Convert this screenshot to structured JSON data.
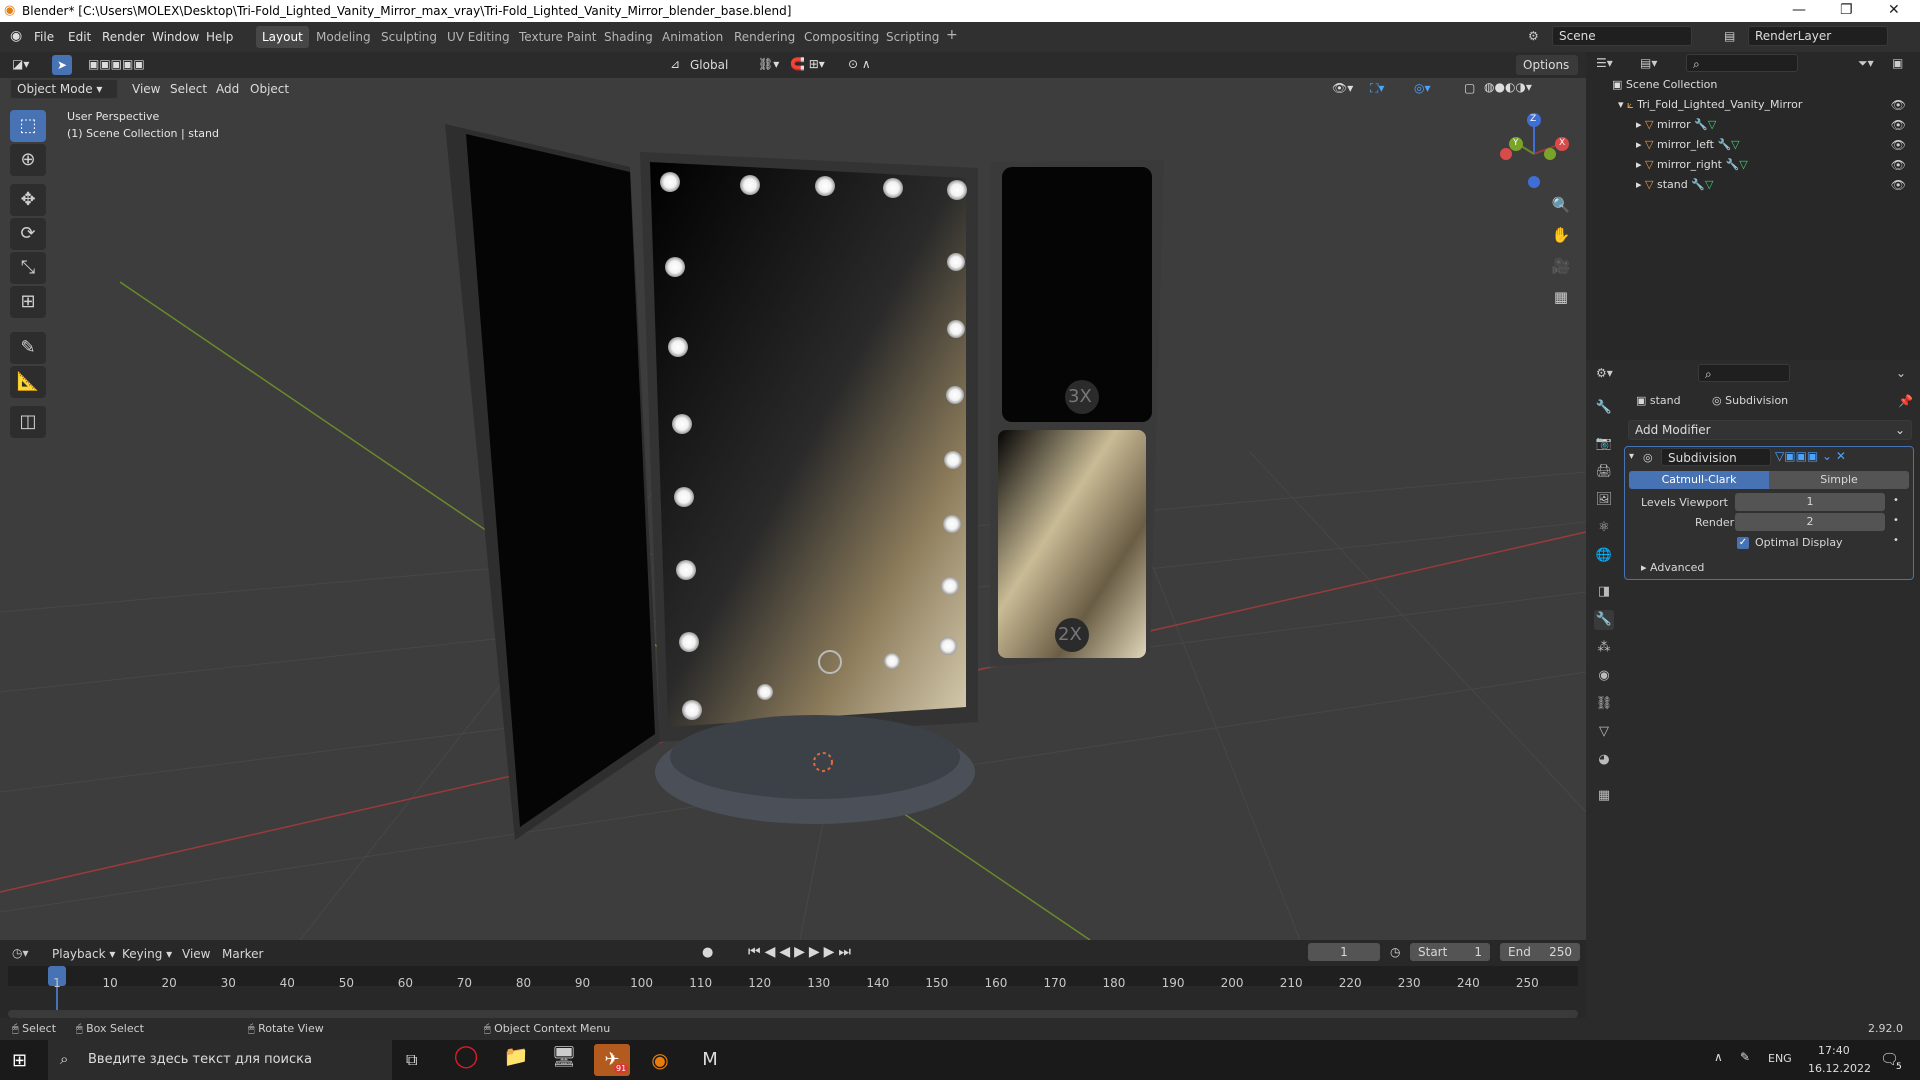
{
  "window": {
    "title": "Blender* [C:\\Users\\MOLEX\\Desktop\\Tri-Fold_Lighted_Vanity_Mirror_max_vray\\Tri-Fold_Lighted_Vanity_Mirror_blender_base.blend]"
  },
  "menu": [
    "File",
    "Edit",
    "Render",
    "Window",
    "Help"
  ],
  "workspaces": [
    "Layout",
    "Modeling",
    "Sculpting",
    "UV Editing",
    "Texture Paint",
    "Shading",
    "Animation",
    "Rendering",
    "Compositing",
    "Scripting"
  ],
  "scene": {
    "label": "Scene",
    "render_layer": "RenderLayer"
  },
  "viewport": {
    "transform": "Global",
    "options": "Options",
    "mode": "Object Mode",
    "menus": [
      "View",
      "Select",
      "Add",
      "Object"
    ],
    "overlay_title": "User Perspective",
    "overlay_sub": "(1) Scene Collection | stand",
    "mirror_labels": {
      "top": "3X",
      "bottom": "2X"
    },
    "gizmo": {
      "x": "X",
      "y": "Y",
      "z": "Z"
    }
  },
  "outliner": {
    "root": "Scene Collection",
    "collection": "Tri_Fold_Lighted_Vanity_Mirror",
    "objects": [
      "mirror",
      "mirror_left",
      "mirror_right",
      "stand"
    ]
  },
  "properties": {
    "object": "stand",
    "modifier_label": "Subdivision",
    "add_modifier": "Add Modifier",
    "modifier_name": "Subdivision",
    "tabs": [
      "Catmull-Clark",
      "Simple"
    ],
    "levels_viewport_label": "Levels Viewport",
    "levels_viewport": "1",
    "render_label": "Render",
    "render": "2",
    "optimal_display": "Optimal Display",
    "optimal_checked": true,
    "advanced": "Advanced"
  },
  "timeline": {
    "menus": [
      "Playback",
      "Keying",
      "View",
      "Marker"
    ],
    "current_frame": "1",
    "start_label": "Start",
    "start": "1",
    "end_label": "End",
    "end": "250",
    "ticks": [
      "1",
      "10",
      "20",
      "30",
      "40",
      "50",
      "60",
      "70",
      "80",
      "90",
      "100",
      "110",
      "120",
      "130",
      "140",
      "150",
      "160",
      "170",
      "180",
      "190",
      "200",
      "210",
      "220",
      "230",
      "240",
      "250"
    ]
  },
  "statusbar": {
    "select": "Select",
    "box_select": "Box Select",
    "rotate": "Rotate View",
    "context": "Object Context Menu",
    "version": "2.92.0"
  },
  "taskbar": {
    "search_placeholder": "Введите здесь текст для поиска",
    "lang": "ENG",
    "time": "17:40",
    "date": "16.12.2022",
    "notif_count": "5",
    "telegram_badge": "91"
  },
  "colors": {
    "accent": "#4772b3",
    "active_tab": "#4aa3ff",
    "x_axis": "#9b3a3a",
    "y_axis": "#6a8a2a",
    "z_axis": "#3f6fd6"
  }
}
